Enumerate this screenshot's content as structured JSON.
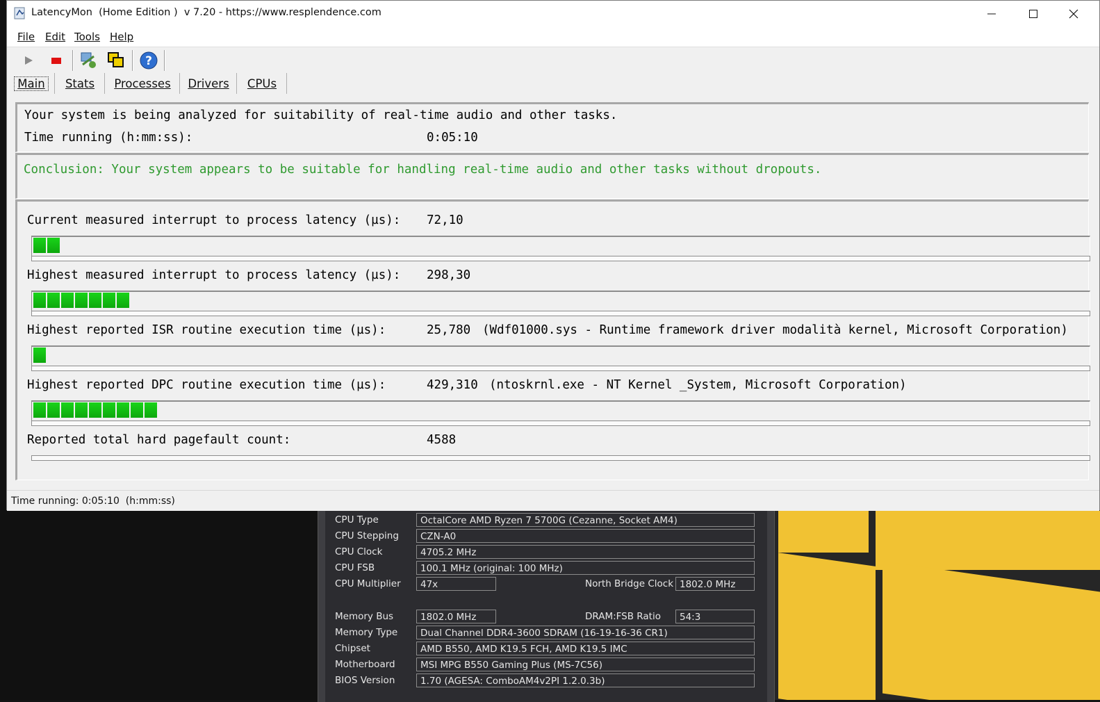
{
  "window": {
    "title": "LatencyMon  (Home Edition )  v 7.20 - https://www.resplendence.com",
    "minimize": "—",
    "maximize": "☐",
    "close": "✕"
  },
  "menu": {
    "file": "File",
    "edit": "Edit",
    "tools": "Tools",
    "help": "Help"
  },
  "toolbar": {
    "play": "▶",
    "stop": "■",
    "help": "?"
  },
  "tabs": [
    {
      "label": "Main"
    },
    {
      "label": "Stats"
    },
    {
      "label": "Processes"
    },
    {
      "label": "Drivers"
    },
    {
      "label": "CPUs"
    }
  ],
  "main": {
    "analysis_text": "Your system is being analyzed for suitability of real-time audio and other tasks.",
    "time_label": "Time running (h:mm:ss):",
    "time_value": "0:05:10",
    "conclusion": "Conclusion: Your system appears to be suitable for handling real-time audio and other tasks without dropouts.",
    "metrics": [
      {
        "label": "Current measured interrupt to process latency (µs):",
        "value": "72,10",
        "detail": "",
        "segments": 2
      },
      {
        "label": "Highest measured interrupt to process latency (µs):",
        "value": "298,30",
        "detail": "",
        "segments": 7
      },
      {
        "label": "Highest reported ISR routine execution time (µs):",
        "value": "25,780",
        "detail": "(Wdf01000.sys - Runtime framework driver modalità kernel, Microsoft Corporation)",
        "segments": 1
      },
      {
        "label": "Highest reported DPC routine execution time (µs):",
        "value": "429,310",
        "detail": "(ntoskrnl.exe - NT Kernel _System, Microsoft Corporation)",
        "segments": 9
      },
      {
        "label": "Reported total hard pagefault count:",
        "value": "4588",
        "detail": "",
        "segments": 0
      }
    ]
  },
  "status": {
    "text": "Time running: 0:05:10  (h:mm:ss)"
  },
  "cpuz": {
    "cpu_type_label": "CPU Type",
    "cpu_type": "OctalCore AMD Ryzen 7 5700G  (Cezanne, Socket AM4)",
    "cpu_stepping_label": "CPU Stepping",
    "cpu_stepping": "CZN-A0",
    "cpu_clock_label": "CPU Clock",
    "cpu_clock": "4705.2 MHz",
    "cpu_fsb_label": "CPU FSB",
    "cpu_fsb": "100.1 MHz  (original: 100 MHz)",
    "cpu_mult_label": "CPU Multiplier",
    "cpu_mult": "47x",
    "nb_clock_label": "North Bridge Clock",
    "nb_clock": "1802.0 MHz",
    "mem_bus_label": "Memory Bus",
    "mem_bus": "1802.0 MHz",
    "dram_ratio_label": "DRAM:FSB Ratio",
    "dram_ratio": "54:3",
    "mem_type_label": "Memory Type",
    "mem_type": "Dual Channel DDR4-3600 SDRAM  (16-19-16-36 CR1)",
    "chipset_label": "Chipset",
    "chipset": "AMD B550, AMD K19.5 FCH, AMD K19.5 IMC",
    "motherboard_label": "Motherboard",
    "motherboard": "MSI MPG B550 Gaming Plus (MS-7C56)",
    "bios_label": "BIOS Version",
    "bios": "1.70  (AGESA: ComboAM4v2PI 1.2.0.3b)"
  }
}
